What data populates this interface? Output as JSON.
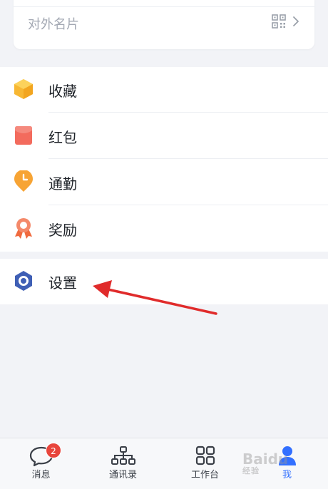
{
  "card": {
    "business_card_label": "对外名片"
  },
  "menu": [
    {
      "label": "收藏",
      "icon": "favorites-box-icon",
      "color": "#f7b733"
    },
    {
      "label": "红包",
      "icon": "red-envelope-icon",
      "color": "#f36b5d"
    },
    {
      "label": "通勤",
      "icon": "commute-clock-icon",
      "color": "#f7a434"
    },
    {
      "label": "奖励",
      "icon": "award-ribbon-icon",
      "color": "#f06a3e"
    }
  ],
  "settings": {
    "label": "设置",
    "icon": "settings-hexagon-icon",
    "color": "#3f5fb5"
  },
  "tabbar": {
    "tabs": [
      {
        "label": "消息",
        "icon": "chat-bubble-icon",
        "badge": "2"
      },
      {
        "label": "通讯录",
        "icon": "org-chart-icon"
      },
      {
        "label": "工作台",
        "icon": "grid-apps-icon"
      },
      {
        "label": "我",
        "icon": "person-icon",
        "active": true
      }
    ]
  },
  "watermark": {
    "text": "Baidu",
    "sub": "经验"
  },
  "colors": {
    "accent": "#3370ff",
    "arrow": "#e02b2b"
  }
}
